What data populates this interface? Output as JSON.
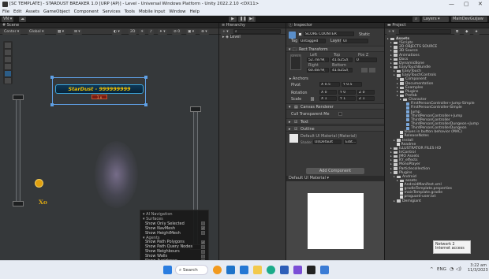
{
  "window": {
    "title": "[SC TEMPLATE] - STARDUST BREAKER 1.0 [URP (AP)] - Level - Universal Windows Platform - Unity 2022.2.10 <DX11>",
    "controls": [
      "—",
      "▢",
      "✕"
    ]
  },
  "menu": [
    "File",
    "Edit",
    "Assets",
    "GameObject",
    "Component",
    "Services",
    "Tools",
    "Mobile Input",
    "Window",
    "Help"
  ],
  "toolbar": {
    "account": "VN ▾",
    "search_icon": "search-icon",
    "layers": "Layers",
    "layout": "MainDevGuijaw"
  },
  "scene": {
    "tab": "Scene",
    "pivot": "Center",
    "space": "Global",
    "mode_2d": "2D",
    "stardust_text": "StarDust - 999999999",
    "sub_text": "1 x",
    "xo": "Xo"
  },
  "hierarchy": {
    "tab": "Hierarchy",
    "item": "Level"
  },
  "navmenu": {
    "items": [
      {
        "label": "AI Navigation",
        "header": true
      },
      {
        "label": "Surfaces",
        "header": true
      },
      {
        "label": "Show Only Selected",
        "checked": false
      },
      {
        "label": "Show NavMesh",
        "checked": true
      },
      {
        "label": "Show HeightMesh",
        "checked": false
      },
      {
        "label": "Agents",
        "header": true
      },
      {
        "label": "Show Path Polygons",
        "checked": true
      },
      {
        "label": "Show Path Query Nodes",
        "checked": false
      },
      {
        "label": "Show Neighbours",
        "checked": false
      },
      {
        "label": "Show Walls",
        "checked": false
      },
      {
        "label": "Show Avoidance",
        "checked": false
      },
      {
        "label": "Obstacles",
        "header": true
      },
      {
        "label": "Show Carve Hull",
        "checked": true
      }
    ]
  },
  "inspector": {
    "tab": "Inspector",
    "object_name": "SCORE COUNTER",
    "static": "Static",
    "tag_label": "Tag",
    "tag_value": "Untagged",
    "layer_label": "Layer",
    "layer_value": "UI",
    "rect_transform": "Rect Transform",
    "stretch": "stretch",
    "left_label": "Left",
    "top_label": "Top",
    "posz_label": "Pos Z",
    "left_val": "52.7879(",
    "top_val": "41.6252(",
    "posz_val": "0",
    "right_label": "Right",
    "bottom_label": "Bottom",
    "right_val": "60.4879(",
    "bottom_val": "41.6252(",
    "anchors": "Anchors",
    "pivot_label": "Pivot",
    "pivot_x": "X 0.5",
    "pivot_y": "Y 0.5",
    "rotation_label": "Rotation",
    "rot_x": "X 0",
    "rot_y": "Y 0",
    "rot_z": "Z 0",
    "scale_label": "Scale",
    "scale_x": "X 1",
    "scale_y": "Y 1",
    "scale_z": "Z 1",
    "canvas_renderer": "Canvas Renderer",
    "cull_label": "Cull Transparent Me",
    "text_comp": "Text",
    "outline_comp": "Outline",
    "material_name": "Default UI Material (Material)",
    "shader_label": "Shader",
    "shader_value": "UI/Default",
    "edit_label": "Edit...",
    "add_component": "Add Component",
    "preview_label": "Default UI Material"
  },
  "project": {
    "tab": "Project",
    "tree": [
      {
        "label": "Assets",
        "depth": 0,
        "icon": "folder",
        "bold": true
      },
      {
        "label": "!Scripts",
        "depth": 1,
        "icon": "folder"
      },
      {
        "label": "2D OBJECTS SOURCE",
        "depth": 1,
        "icon": "folder"
      },
      {
        "label": "3D Source",
        "depth": 1,
        "icon": "folder"
      },
      {
        "label": "Animations",
        "depth": 1,
        "icon": "folder"
      },
      {
        "label": "Docs",
        "depth": 1,
        "icon": "folder"
      },
      {
        "label": "DynamicBone",
        "depth": 1,
        "icon": "folder"
      },
      {
        "label": "EasyTouchBundle",
        "depth": 1,
        "icon": "folder"
      },
      {
        "label": "EasyTouch",
        "depth": 2,
        "icon": "folder"
      },
      {
        "label": "EasyTouchControls",
        "depth": 2,
        "icon": "folder"
      },
      {
        "label": "Component",
        "depth": 3,
        "icon": "folder"
      },
      {
        "label": "Documentation",
        "depth": 3,
        "icon": "folder"
      },
      {
        "label": "Examples",
        "depth": 3,
        "icon": "folder"
      },
      {
        "label": "Plugins",
        "depth": 3,
        "icon": "folder"
      },
      {
        "label": "Prefab",
        "depth": 3,
        "icon": "folder"
      },
      {
        "label": "Character",
        "depth": 4,
        "icon": "folder"
      },
      {
        "label": "FirstPersonController+Jump-Simple",
        "depth": 5,
        "icon": "cube"
      },
      {
        "label": "FirstPersonController-Simple",
        "depth": 5,
        "icon": "cube"
      },
      {
        "label": "Jump",
        "depth": 5,
        "icon": "cube"
      },
      {
        "label": "ThirdPersonController+Jump",
        "depth": 5,
        "icon": "cube"
      },
      {
        "label": "ThirdPersonController",
        "depth": 5,
        "icon": "cube"
      },
      {
        "label": "ThirdPersonControllerDungeon+Jump",
        "depth": 5,
        "icon": "cube"
      },
      {
        "label": "ThirdPersonControllerDungeon",
        "depth": 5,
        "icon": "cube"
      },
      {
        "label": "Issues in button behavior (MAC)",
        "depth": 3,
        "icon": "file"
      },
      {
        "label": "ReleaseNotes",
        "depth": 3,
        "icon": "file"
      },
      {
        "label": "Install",
        "depth": 2,
        "icon": "folder"
      },
      {
        "label": "Readme",
        "depth": 2,
        "icon": "file"
      },
      {
        "label": "ILLUSTRATOR FILES HD",
        "depth": 1,
        "icon": "folder"
      },
      {
        "label": "InControl",
        "depth": 1,
        "icon": "folder"
      },
      {
        "label": "JMO Assets",
        "depth": 1,
        "icon": "folder"
      },
      {
        "label": "KY_effects",
        "depth": 1,
        "icon": "folder"
      },
      {
        "label": "MonoPlayer",
        "depth": 1,
        "icon": "folder"
      },
      {
        "label": "Particlecollection",
        "depth": 1,
        "icon": "folder"
      },
      {
        "label": "Plugins",
        "depth": 1,
        "icon": "folder"
      },
      {
        "label": "Android",
        "depth": 2,
        "icon": "folder"
      },
      {
        "label": "assets",
        "depth": 3,
        "icon": "folder"
      },
      {
        "label": "AndroidManifest.xml",
        "depth": 3,
        "icon": "file"
      },
      {
        "label": "gradleTemplate.properties",
        "depth": 3,
        "icon": "file"
      },
      {
        "label": "mainTemplate.gradle",
        "depth": 3,
        "icon": "file"
      },
      {
        "label": "proguard-user.txt",
        "depth": 3,
        "icon": "file"
      },
      {
        "label": "Demigiant",
        "depth": 2,
        "icon": "folder"
      }
    ]
  },
  "network_toast": {
    "title": "Network 2",
    "subtitle": "Internet access"
  },
  "taskbar": {
    "search": "Search",
    "lang": "ENG",
    "time": "3:22 am",
    "date": "11/3/2023"
  },
  "colors": {
    "accent": "#2c5d87",
    "stardust": "#f2c200",
    "xo": "#d9a514"
  }
}
